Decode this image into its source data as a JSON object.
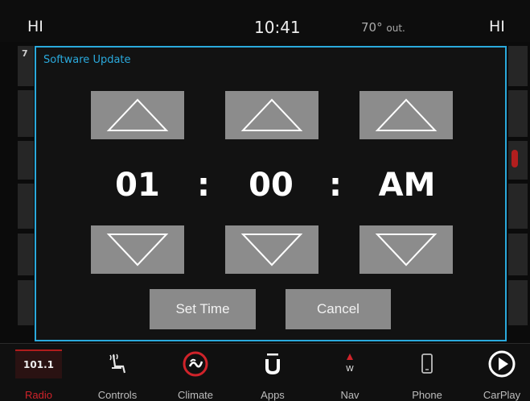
{
  "status_bar": {
    "left_label": "HI",
    "time": "10:41",
    "outside_temp": "70°",
    "outside_unit": "out.",
    "right_label": "HI"
  },
  "background": {
    "badge_left": "7"
  },
  "dialog": {
    "title": "Software Update",
    "hour": "01",
    "separator1": ":",
    "minute": "00",
    "separator2": ":",
    "meridiem": "AM",
    "set_time_label": "Set Time",
    "cancel_label": "Cancel"
  },
  "dock": {
    "radio_frequency": "101.1",
    "nav_compass": "W",
    "items": [
      {
        "label": "Radio",
        "icon": "radio-frequency-tile",
        "active": true
      },
      {
        "label": "Controls",
        "icon": "seat-controls-icon",
        "active": false
      },
      {
        "label": "Climate",
        "icon": "climate-icon",
        "active": false
      },
      {
        "label": "Apps",
        "icon": "apps-u-icon",
        "active": false
      },
      {
        "label": "Nav",
        "icon": "compass-icon",
        "active": false
      },
      {
        "label": "Phone",
        "icon": "phone-icon",
        "active": false
      },
      {
        "label": "CarPlay",
        "icon": "carplay-play-icon",
        "active": false
      }
    ]
  },
  "colors": {
    "accent": "#2aa9dc",
    "active": "#d0232a",
    "button": "#8c8c8c"
  }
}
